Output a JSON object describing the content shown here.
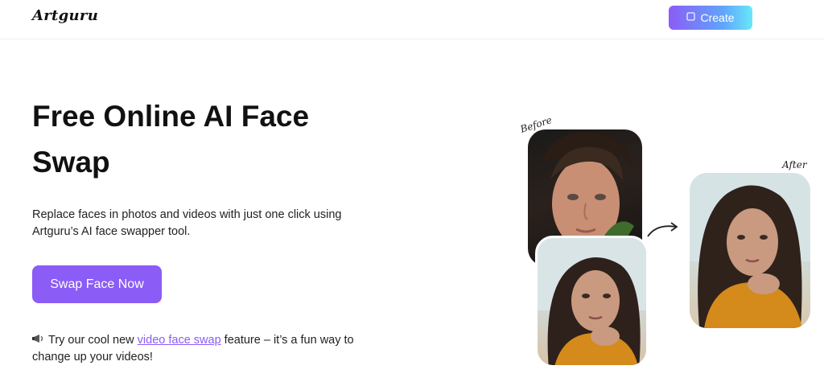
{
  "header": {
    "logo_text": "Artguru",
    "create_label": "Create",
    "create_icon": "plus-icon"
  },
  "hero": {
    "title": "Free Online AI Face Swap",
    "description": "Replace faces in photos and videos with just one click using Artguru’s AI face swapper tool.",
    "cta_label": "Swap Face Now"
  },
  "promo": {
    "icon": "megaphone-icon",
    "text_before": "Try our cool new ",
    "link_text": "video face swap",
    "text_after": " feature – it’s a fun way to change up your videos!"
  },
  "visual": {
    "before_label": "Before",
    "after_label": "After"
  },
  "colors": {
    "accent": "#8b5cf6",
    "gradient_end": "#67e8f9"
  }
}
